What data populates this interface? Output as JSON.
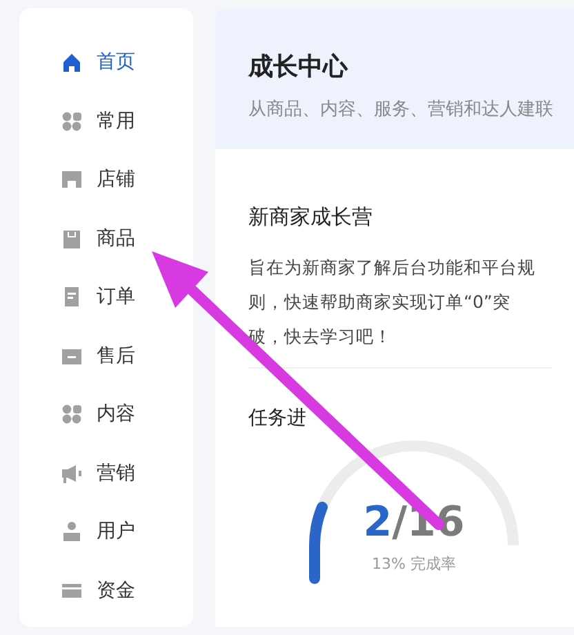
{
  "sidebar": {
    "items": [
      {
        "label": "首页",
        "selected": true
      },
      {
        "label": "常用",
        "selected": false
      },
      {
        "label": "店铺",
        "selected": false
      },
      {
        "label": "商品",
        "selected": false
      },
      {
        "label": "订单",
        "selected": false
      },
      {
        "label": "售后",
        "selected": false
      },
      {
        "label": "内容",
        "selected": false
      },
      {
        "label": "营销",
        "selected": false
      },
      {
        "label": "用户",
        "selected": false
      },
      {
        "label": "资金",
        "selected": false
      }
    ]
  },
  "header": {
    "title": "成长中心",
    "subtitle": "从商品、内容、服务、营销和达人建联"
  },
  "camp": {
    "title": "新商家成长营",
    "description": "旨在为新商家了解后台功能和平台规则，快速帮助商家实现订单“0”突破，快去学习吧！"
  },
  "progress": {
    "title": "任务进",
    "done": "2",
    "total": "/16",
    "level": 0.125,
    "caption": "13% 完成率"
  }
}
